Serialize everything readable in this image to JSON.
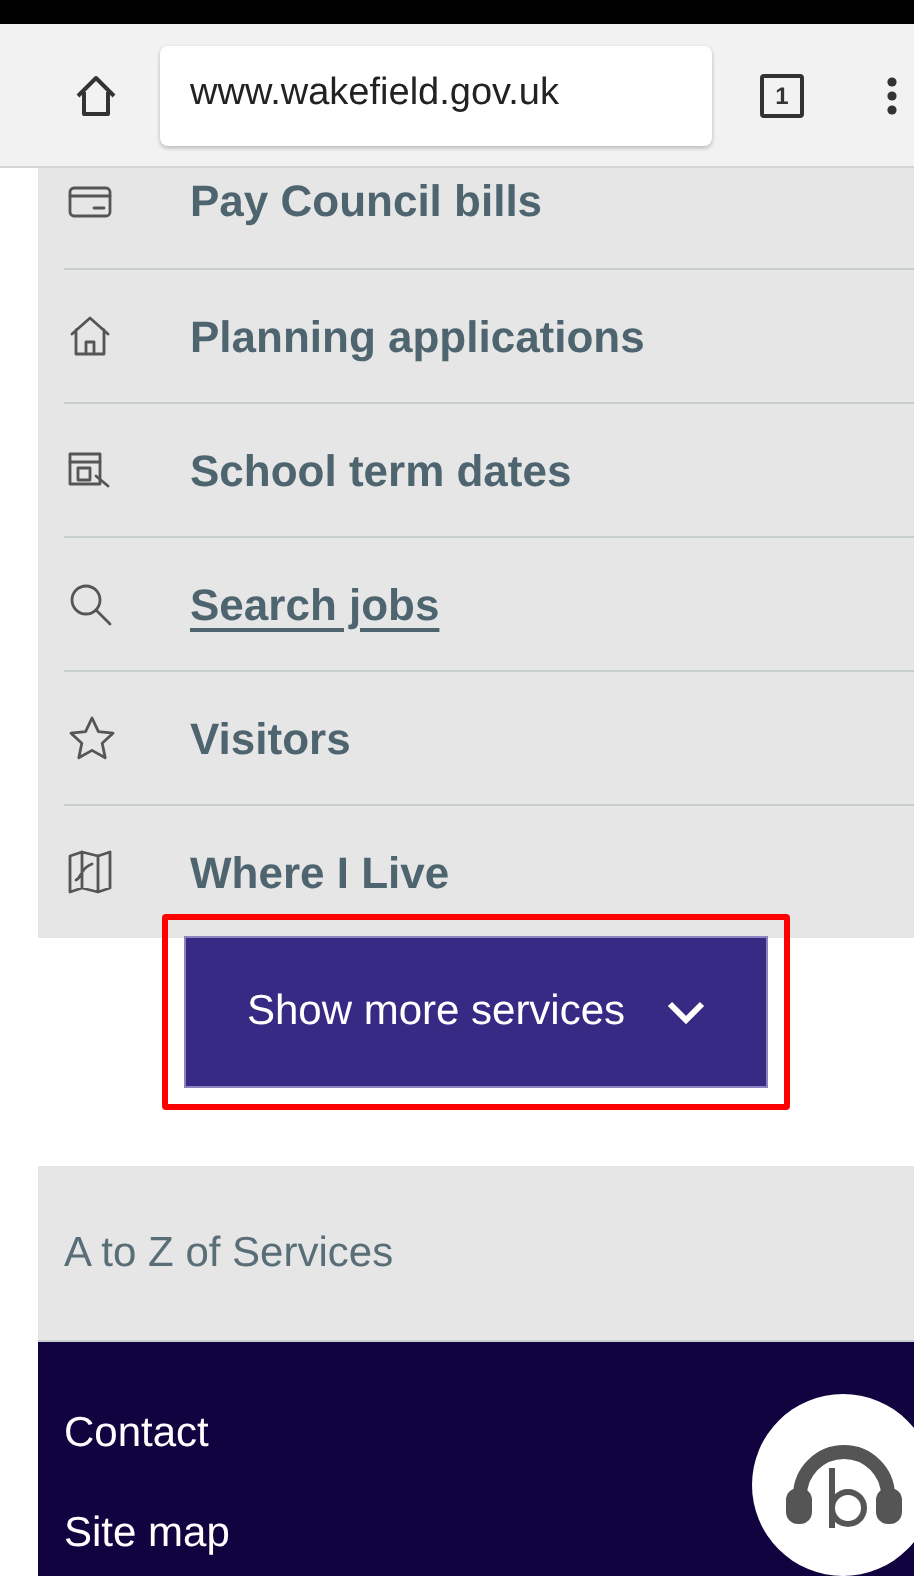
{
  "browser": {
    "url": "www.wakefield.gov.uk",
    "tab_count": "1"
  },
  "services": [
    {
      "label": "Pay Council bills",
      "underlined": false
    },
    {
      "label": "Planning applications",
      "underlined": false
    },
    {
      "label": "School term dates",
      "underlined": false
    },
    {
      "label": "Search jobs",
      "underlined": true
    },
    {
      "label": "Visitors",
      "underlined": false
    },
    {
      "label": "Where I Live",
      "underlined": false
    }
  ],
  "show_more_button": {
    "label": "Show more services",
    "highlighted": true
  },
  "a_to_z": {
    "label": "A to Z of Services"
  },
  "footer_links": [
    "Contact",
    "Site map"
  ]
}
